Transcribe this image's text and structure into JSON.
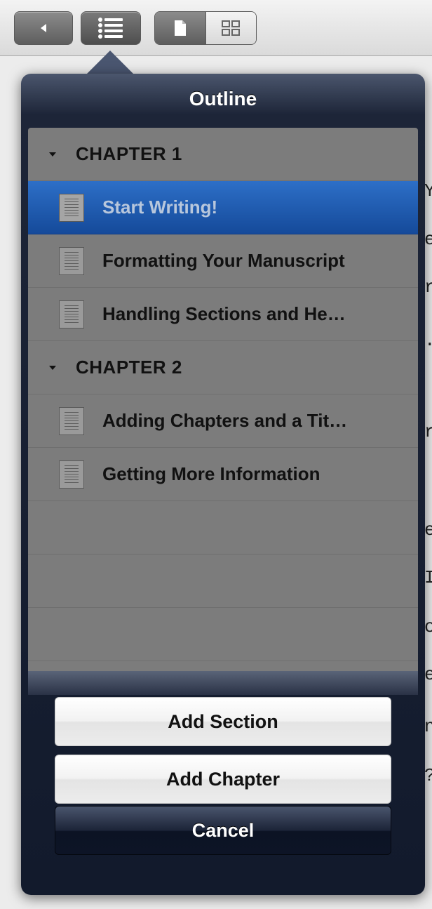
{
  "popover": {
    "title": "Outline",
    "rows": [
      {
        "type": "chapter",
        "label": "CHAPTER 1"
      },
      {
        "type": "section",
        "label": "Start Writing!",
        "selected": true
      },
      {
        "type": "section",
        "label": "Formatting Your Manuscript"
      },
      {
        "type": "section",
        "label": "Handling Sections and He…"
      },
      {
        "type": "chapter",
        "label": "CHAPTER 2"
      },
      {
        "type": "section",
        "label": "Adding Chapters and a Tit…"
      },
      {
        "type": "section",
        "label": "Getting More Information"
      }
    ]
  },
  "actions": {
    "add_section": "Add Section",
    "add_chapter": "Add Chapter",
    "cancel": "Cancel"
  },
  "background_doc": [
    "Y",
    "e",
    "r",
    ".",
    "r",
    "e",
    "I",
    "c",
    "e",
    "n",
    "?"
  ],
  "colors": {
    "selection": "#1f5cb3",
    "popover": "#121a2c",
    "list_bg": "#7c7c7c"
  },
  "icons": [
    "back-arrow-icon",
    "outline-list-icon",
    "page-view-icon",
    "grid-view-icon",
    "document-icon",
    "disclosure-triangle-icon"
  ]
}
